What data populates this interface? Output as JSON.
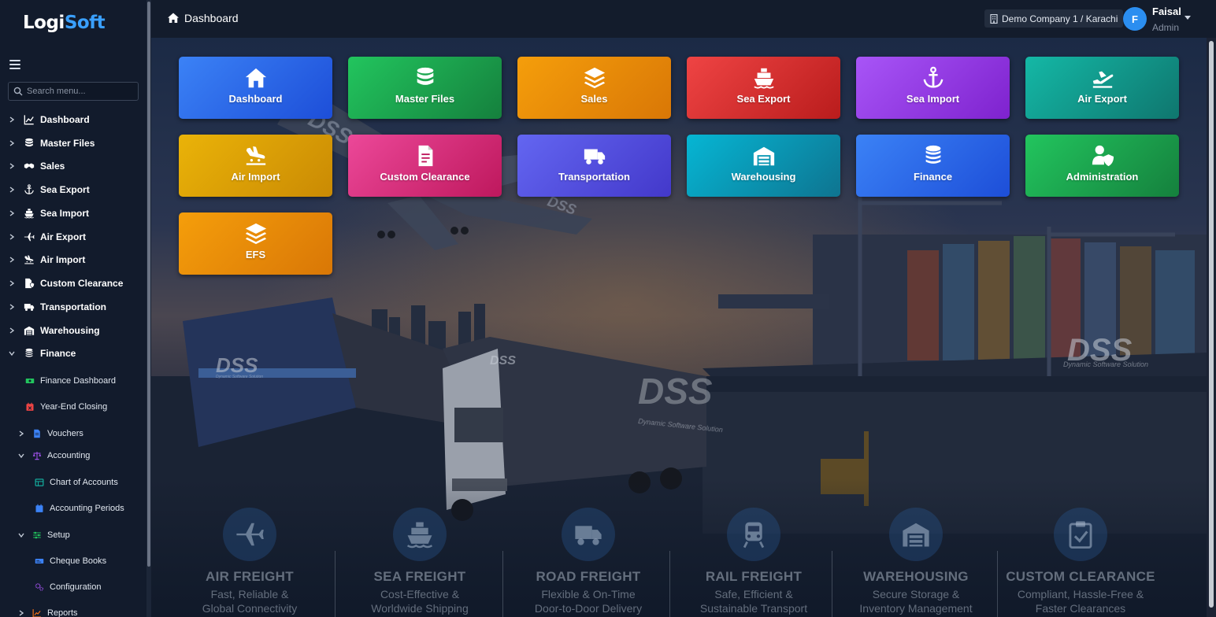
{
  "app": {
    "logo_a": "Logi",
    "logo_b": "Soft"
  },
  "sidebar": {
    "search_placeholder": "Search menu...",
    "items": [
      {
        "label": "Dashboard",
        "icon": "chart-line-icon"
      },
      {
        "label": "Master Files",
        "icon": "database-icon"
      },
      {
        "label": "Sales",
        "icon": "handshake-icon"
      },
      {
        "label": "Sea Export",
        "icon": "anchor-icon"
      },
      {
        "label": "Sea Import",
        "icon": "ship-icon"
      },
      {
        "label": "Air Export",
        "icon": "plane-icon"
      },
      {
        "label": "Air Import",
        "icon": "plane-arrival-icon"
      },
      {
        "label": "Custom Clearance",
        "icon": "file-shield-icon"
      },
      {
        "label": "Transportation",
        "icon": "truck-icon"
      },
      {
        "label": "Warehousing",
        "icon": "warehouse-icon"
      },
      {
        "label": "Finance",
        "icon": "coins-icon"
      }
    ],
    "finance_children": [
      {
        "label": "Finance Dashboard",
        "icon": "money-icon",
        "color": "#22c55e"
      },
      {
        "label": "Year-End Closing",
        "icon": "calendar-x-icon",
        "color": "#ef4444"
      },
      {
        "label": "Vouchers",
        "icon": "file-icon",
        "color": "#3b82f6"
      },
      {
        "label": "Accounting",
        "icon": "scale-icon",
        "color": "#a855f7"
      },
      {
        "label": "Chart of Accounts",
        "icon": "table-icon",
        "color": "#14b8a6"
      },
      {
        "label": "Accounting Periods",
        "icon": "calendar-icon",
        "color": "#3b82f6"
      },
      {
        "label": "Setup",
        "icon": "sliders-icon",
        "color": "#22c55e"
      },
      {
        "label": "Cheque Books",
        "icon": "cheque-icon",
        "color": "#3b82f6"
      },
      {
        "label": "Configuration",
        "icon": "cogs-icon",
        "color": "#a855f7"
      },
      {
        "label": "Reports",
        "icon": "chart-icon",
        "color": "#f97316"
      }
    ]
  },
  "header": {
    "breadcrumb": "Dashboard",
    "company": "Demo Company 1 / Karachi",
    "user": {
      "initial": "F",
      "name": "Faisal",
      "role": "Admin"
    }
  },
  "tiles": [
    {
      "label": "Dashboard",
      "icon": "home-icon",
      "color_a": "#3b82f6",
      "color_b": "#1d4ed8"
    },
    {
      "label": "Master Files",
      "icon": "database-icon",
      "color_a": "#22c55e",
      "color_b": "#15803d"
    },
    {
      "label": "Sales",
      "icon": "layers-icon",
      "color_a": "#f59e0b",
      "color_b": "#d97706"
    },
    {
      "label": "Sea Export",
      "icon": "ship-icon",
      "color_a": "#ef4444",
      "color_b": "#b91c1c"
    },
    {
      "label": "Sea Import",
      "icon": "anchor-icon",
      "color_a": "#a855f7",
      "color_b": "#7e22ce"
    },
    {
      "label": "Air Export",
      "icon": "plane-departure-icon",
      "color_a": "#14b8a6",
      "color_b": "#0f766e"
    },
    {
      "label": "Air Import",
      "icon": "plane-arrival-icon",
      "color_a": "#eab308",
      "color_b": "#ca8a04"
    },
    {
      "label": "Custom Clearance",
      "icon": "file-invoice-icon",
      "color_a": "#ec4899",
      "color_b": "#be185d"
    },
    {
      "label": "Transportation",
      "icon": "truck-icon",
      "color_a": "#6366f1",
      "color_b": "#4338ca"
    },
    {
      "label": "Warehousing",
      "icon": "warehouse-icon",
      "color_a": "#06b6d4",
      "color_b": "#0e7490"
    },
    {
      "label": "Finance",
      "icon": "coins-icon",
      "color_a": "#3b82f6",
      "color_b": "#1d4ed8"
    },
    {
      "label": "Administration",
      "icon": "user-shield-icon",
      "color_a": "#22c55e",
      "color_b": "#15803d"
    },
    {
      "label": "EFS",
      "icon": "layers-icon",
      "color_a": "#f59e0b",
      "color_b": "#d97706"
    }
  ],
  "background": {
    "watermark": "DSS",
    "tagline": "Dynamic Software Solution",
    "services": [
      {
        "title": "AIR FREIGHT",
        "line1": "Fast, Reliable &",
        "line2": "Global Connectivity",
        "icon": "plane-icon"
      },
      {
        "title": "SEA FREIGHT",
        "line1": "Cost-Effective &",
        "line2": "Worldwide Shipping",
        "icon": "ship-icon"
      },
      {
        "title": "ROAD FREIGHT",
        "line1": "Flexible & On-Time",
        "line2": "Door-to-Door Delivery",
        "icon": "truck-icon"
      },
      {
        "title": "RAIL FREIGHT",
        "line1": "Safe, Efficient &",
        "line2": "Sustainable Transport",
        "icon": "train-icon"
      },
      {
        "title": "WAREHOUSING",
        "line1": "Secure Storage &",
        "line2": "Inventory Management",
        "icon": "warehouse-icon"
      },
      {
        "title": "CUSTOM CLEARANCE",
        "line1": "Compliant, Hassle-Free &",
        "line2": "Faster Clearances",
        "icon": "clipboard-check-icon"
      }
    ]
  }
}
